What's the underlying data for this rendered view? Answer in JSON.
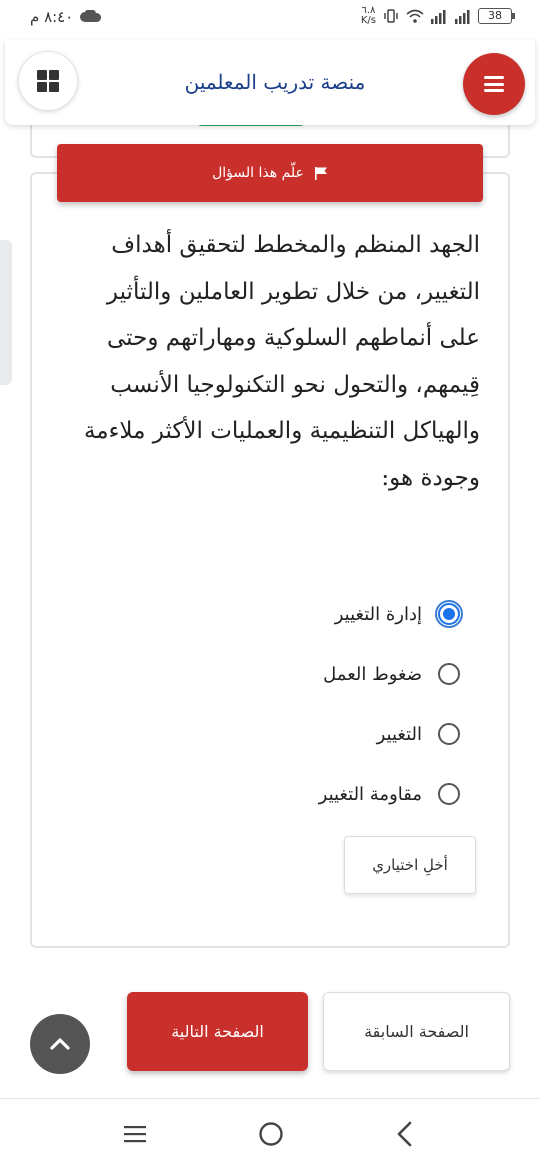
{
  "status_bar": {
    "time": "٨:٤٠ م",
    "network_speed_value": "٦.٨",
    "network_speed_unit": "K/s",
    "battery": "38"
  },
  "header": {
    "title": "منصة تدريب المعلمين",
    "icons": {
      "left": "grid-icon",
      "right": "menu-icon"
    }
  },
  "question": {
    "flag_label": "علّم هذا السؤال",
    "text": "الجهد المنظم والمخطط لتحقيق أهداف التغيير، من خلال تطوير العاملين والتأثير على أنماطهم السلوكية ومهاراتهم وحتى قِيمهم، والتحول نحو التكنولوجيا الأنسب والهياكل التنظيمية والعمليات الأكثر ملاءمة وجودة هو:",
    "options": [
      {
        "label": "إدارة التغيير",
        "selected": true
      },
      {
        "label": "ضغوط العمل",
        "selected": false
      },
      {
        "label": "التغيير",
        "selected": false
      },
      {
        "label": "مقاومة التغيير",
        "selected": false
      }
    ],
    "clear_label": "أخلِ اختياري"
  },
  "pagination": {
    "next_label": "الصفحة التالية",
    "previous_label": "الصفحة السابقة"
  },
  "colors": {
    "primary_red": "#c9302c",
    "title_blue": "#1c3f8c",
    "radio_blue": "#1a73e8",
    "scroll_button_gray": "#555555"
  }
}
